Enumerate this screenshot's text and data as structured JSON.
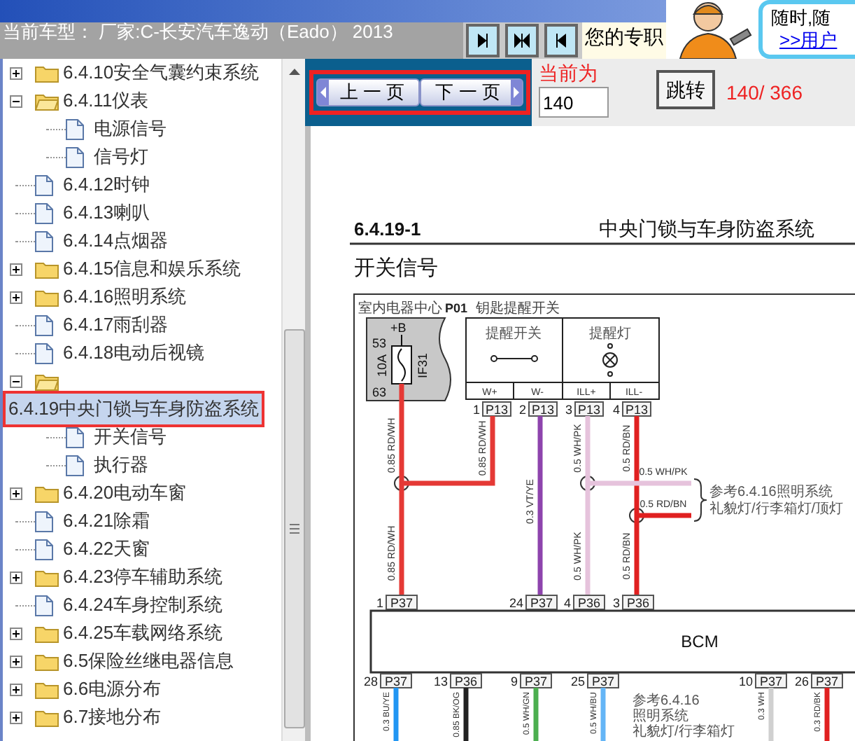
{
  "header": {
    "car_model": "当前车型： 厂家:C-长安汽车逸动（Eado） 2013",
    "promo_text": "您的专职",
    "tip": {
      "text": "随时,随",
      "link": ">>用户"
    }
  },
  "toolbar": {
    "prev": "上 一 页",
    "next": "下 一 页",
    "current_label": "当前为",
    "page_input": "140",
    "jump": "跳转",
    "page_count": "140/ 366"
  },
  "tree": [
    {
      "label": "6.4.10安全气囊约束系统",
      "kind": "folder",
      "expanded": false,
      "selected": false
    },
    {
      "label": "6.4.11仪表",
      "kind": "folder",
      "expanded": true,
      "selected": false,
      "children": [
        {
          "label": "电源信号",
          "kind": "doc",
          "selected": false
        },
        {
          "label": "信号灯",
          "kind": "doc",
          "selected": false
        }
      ]
    },
    {
      "label": "6.4.12时钟",
      "kind": "doc",
      "selected": false
    },
    {
      "label": "6.4.13喇叭",
      "kind": "doc",
      "selected": false
    },
    {
      "label": "6.4.14点烟器",
      "kind": "doc",
      "selected": false
    },
    {
      "label": "6.4.15信息和娱乐系统",
      "kind": "folder",
      "expanded": false,
      "selected": false
    },
    {
      "label": "6.4.16照明系统",
      "kind": "folder",
      "expanded": false,
      "selected": false
    },
    {
      "label": "6.4.17雨刮器",
      "kind": "doc",
      "selected": false
    },
    {
      "label": "6.4.18电动后视镜",
      "kind": "doc",
      "selected": false
    },
    {
      "label": "6.4.19中央门锁与车身防盗系统",
      "kind": "folder",
      "expanded": true,
      "selected": true,
      "children": [
        {
          "label": "开关信号",
          "kind": "doc",
          "selected": false
        },
        {
          "label": "执行器",
          "kind": "doc",
          "selected": false
        }
      ]
    },
    {
      "label": "6.4.20电动车窗",
      "kind": "folder",
      "expanded": false,
      "selected": false
    },
    {
      "label": "6.4.21除霜",
      "kind": "doc",
      "selected": false
    },
    {
      "label": "6.4.22天窗",
      "kind": "doc",
      "selected": false
    },
    {
      "label": "6.4.23停车辅助系统",
      "kind": "folder",
      "expanded": false,
      "selected": false
    },
    {
      "label": "6.4.24车身控制系统",
      "kind": "doc",
      "selected": false
    },
    {
      "label": "6.4.25车载网络系统",
      "kind": "folder",
      "expanded": false,
      "selected": false
    },
    {
      "label": "6.5保险丝继电器信息",
      "kind": "folder",
      "expanded": false,
      "selected": false
    },
    {
      "label": "6.6电源分布",
      "kind": "folder",
      "expanded": false,
      "selected": false
    },
    {
      "label": "6.7接地分布",
      "kind": "folder",
      "expanded": false,
      "selected": false
    }
  ],
  "diagram": {
    "code": "6.4.19-1",
    "title": "中央门锁与车身防盗系统",
    "subtitle": "开关信号",
    "fuse_box": {
      "name": "室内电器中心",
      "connector": "P01",
      "supply": "+B",
      "pin_in": "53",
      "rating": "10A",
      "fuse": "IF31",
      "pin_out": "63"
    },
    "switch": {
      "name": "钥匙提醒开关",
      "sections": [
        "提醒开关",
        "提醒灯"
      ],
      "pins": [
        "W+",
        "W-",
        "ILL+",
        "ILL-"
      ]
    },
    "switch_connectors": [
      {
        "pin": "1",
        "name": "P13"
      },
      {
        "pin": "2",
        "name": "P13"
      },
      {
        "pin": "3",
        "name": "P13"
      },
      {
        "pin": "4",
        "name": "P13"
      }
    ],
    "top_wires": [
      {
        "labels": [
          "0.85 RD/WH",
          "0.85 RD/WH"
        ],
        "color": "#e53935"
      },
      {
        "labels": [
          "0.85 RD/WH"
        ],
        "color": "#e53935"
      },
      {
        "labels": [
          "0.3 VT/YE"
        ],
        "color": "#8e44ad"
      },
      {
        "labels": [
          "0.5 WH/PK",
          "0.5 WH/PK"
        ],
        "color": "#e6c3dc"
      },
      {
        "labels": [
          "0.5 RD/BN",
          "0.5 RD/BN"
        ],
        "color": "#e02020"
      }
    ],
    "branches": [
      {
        "label": "0.5 WH/PK",
        "color": "#e6c3dc"
      },
      {
        "label": "0.5 RD/BN",
        "color": "#e02020"
      }
    ],
    "branch_note": [
      "参考6.4.16照明系统",
      "礼貌灯/行李箱灯/顶灯"
    ],
    "bcm": {
      "name": "BCM",
      "top_connectors": [
        {
          "pin": "1",
          "name": "P37"
        },
        {
          "pin": "24",
          "name": "P37"
        },
        {
          "pin": "4",
          "name": "P36"
        },
        {
          "pin": "3",
          "name": "P36"
        }
      ],
      "bottom_connectors": [
        {
          "pin": "28",
          "name": "P37",
          "wire": "0.3 BU/YE",
          "color": "#2196f3"
        },
        {
          "pin": "13",
          "name": "P36",
          "wire": "0.85 BK/OG",
          "color": "#222222"
        },
        {
          "pin": "9",
          "name": "P37",
          "wire": "0.5 WH/GN",
          "color": "#4caf50"
        },
        {
          "pin": "25",
          "name": "P37",
          "wire": "0.5 WH/BU",
          "color": "#64b5f6"
        },
        {
          "pin": "10",
          "name": "P37",
          "wire": "0.3 WH",
          "color": "#d0d0d0"
        },
        {
          "pin": "26",
          "name": "P37",
          "wire": "0.3 RD/BK",
          "color": "#e02020"
        }
      ]
    },
    "bottom_note": [
      "参考6.4.16",
      "照明系统",
      "礼貌灯/行李箱灯"
    ]
  }
}
